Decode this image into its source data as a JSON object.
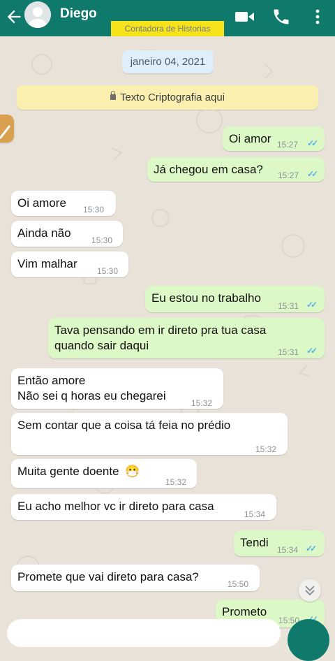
{
  "header": {
    "contact_name": "Diego",
    "watermark": "Contadora de Historias",
    "icons": [
      "back-arrow-icon",
      "avatar",
      "video-call-icon",
      "phone-icon",
      "more-vert-icon"
    ]
  },
  "chat": {
    "date_chip": "janeiro 04, 2021",
    "encryption_notice": "Texto Criptografia aqui",
    "messages": [
      {
        "dir": "out",
        "lines": [
          "Oi amor"
        ],
        "time": "15:27"
      },
      {
        "dir": "out",
        "lines": [
          "Já chegou em casa?"
        ],
        "time": "15:27"
      },
      {
        "dir": "in",
        "lines": [
          "Oi amore"
        ],
        "time": "15:30"
      },
      {
        "dir": "in",
        "lines": [
          "Ainda não"
        ],
        "time": "15:30"
      },
      {
        "dir": "in",
        "lines": [
          "Vim malhar"
        ],
        "time": "15:30"
      },
      {
        "dir": "out",
        "lines": [
          "Eu estou no trabalho"
        ],
        "time": "15:31"
      },
      {
        "dir": "out",
        "lines": [
          "Tava pensando em ir direto pra tua casa",
          "quando sair daqui"
        ],
        "time": "15:31"
      },
      {
        "dir": "in",
        "lines": [
          "Então amore",
          "Não sei q horas eu chegarei"
        ],
        "time": "15:32"
      },
      {
        "dir": "in",
        "lines": [
          "Sem contar que a coisa tá feia no prédio"
        ],
        "time": "15:32"
      },
      {
        "dir": "in",
        "lines": [
          "Muita gente doente"
        ],
        "time": "15:32",
        "emoji": "😷"
      },
      {
        "dir": "in",
        "lines": [
          "Eu acho melhor vc ir direto para casa"
        ],
        "time": "15:34"
      },
      {
        "dir": "out",
        "lines": [
          "Tendi"
        ],
        "time": "15:34"
      },
      {
        "dir": "in",
        "lines": [
          "Promete que vai direto para casa?"
        ],
        "time": "15:50"
      },
      {
        "dir": "out",
        "lines": [
          "Prometo"
        ],
        "time": "15:50"
      }
    ]
  },
  "colors": {
    "header": "#0f7a6c",
    "outgoing_bubble": "#dcf8c6",
    "incoming_bubble": "#ffffff",
    "read_ticks": "#4fb3e8",
    "watermark_bg": "#f6e21b"
  }
}
